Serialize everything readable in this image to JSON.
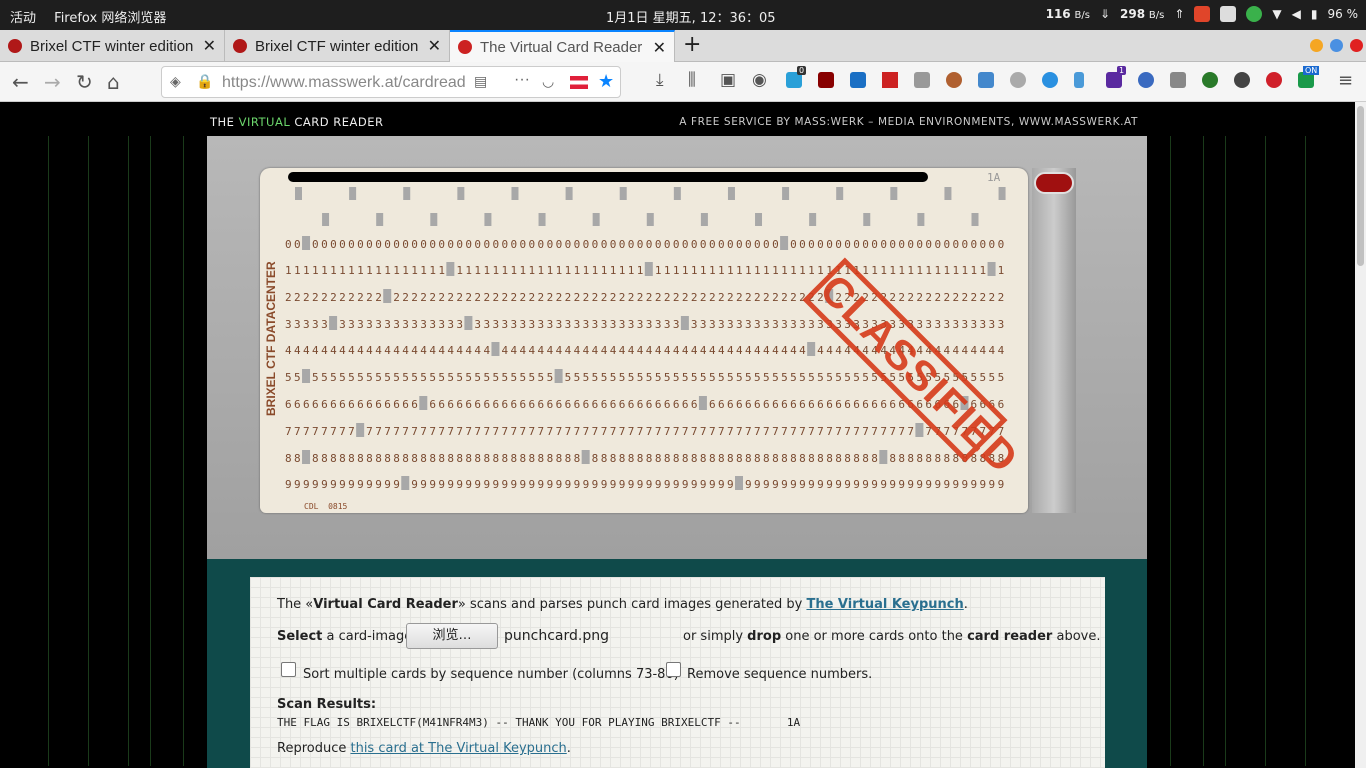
{
  "system": {
    "activities": "活动",
    "app": "Firefox 网络浏览器",
    "clock": "1月1日 星期五, 12：36：05",
    "down_rate": "116",
    "down_unit": "B/s",
    "up_rate": "298",
    "up_unit": "B/s",
    "battery": "96 %"
  },
  "tabs": [
    {
      "label": "Brixel CTF winter edition",
      "close": "✕"
    },
    {
      "label": "Brixel CTF winter edition",
      "close": "✕"
    },
    {
      "label": "The Virtual Card Reader",
      "close": "✕"
    }
  ],
  "new_tab": "+",
  "address": {
    "url": "https://www.masswerk.at/cardreader/"
  },
  "ext_badges": {
    "badge1": "0",
    "badge2": "1",
    "on": "ON"
  },
  "page": {
    "header_left_a": "THE ",
    "header_left_b": "VIRTUAL",
    "header_left_c": " CARD READER",
    "header_right": "A FREE SERVICE BY MASS:WERK – MEDIA ENVIRONMENTS, WWW.MASSWERK.AT"
  },
  "card": {
    "vertical_text": "BRIXEL CTF DATACENTER",
    "corner_label": "1A",
    "bottom_label": "CDL  0815",
    "stamp": "CLASSIFIED"
  },
  "panel": {
    "intro_a": "The «",
    "intro_b": "Virtual Card Reader",
    "intro_c": "» scans and parses punch card images generated by ",
    "intro_link": "The Virtual Keypunch",
    "intro_d": ".",
    "select_a": "Select",
    "select_b": " a card-image:",
    "browse": "浏览…",
    "filename": "punchcard.png",
    "or_a": "or simply ",
    "or_b": "drop",
    "or_c": " one or more cards onto the ",
    "or_d": "card reader",
    "or_e": " above.",
    "sort_label": "Sort multiple cards by sequence number (columns 73-80)",
    "remove_label": "Remove sequence numbers.",
    "scan_title": "Scan Results:",
    "scan_text": "THE FLAG IS BRIXELCTF(M41NFR4M3) -- THANK YOU FOR PLAYING BRIXELCTF --       1A",
    "reproduce_a": "Reproduce ",
    "reproduce_link": "this card at The Virtual Keypunch",
    "reproduce_b": "."
  }
}
